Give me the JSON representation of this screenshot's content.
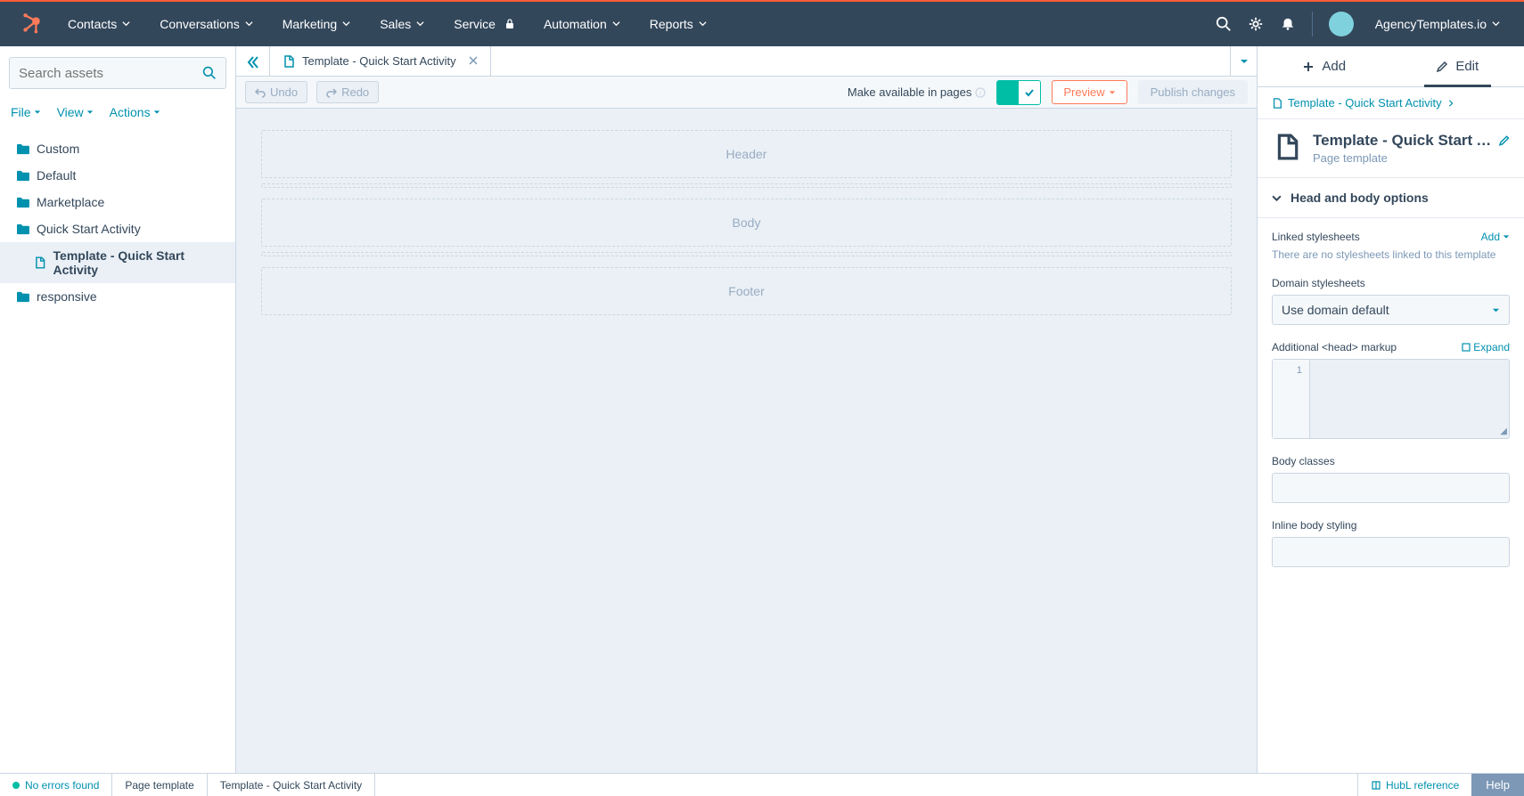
{
  "nav": {
    "items": [
      "Contacts",
      "Conversations",
      "Marketing",
      "Sales",
      "Service",
      "Automation",
      "Reports"
    ],
    "account": "AgencyTemplates.io"
  },
  "sidebar": {
    "search_placeholder": "Search assets",
    "actions": [
      "File",
      "View",
      "Actions"
    ],
    "folders": [
      "Custom",
      "Default",
      "Marketplace",
      "Quick Start Activity"
    ],
    "active_file": "Template - Quick Start Activity",
    "tail_folder": "responsive"
  },
  "tab": {
    "label": "Template - Quick Start Activity"
  },
  "toolbar": {
    "undo": "Undo",
    "redo": "Redo",
    "avail_label": "Make available in pages",
    "preview": "Preview",
    "publish": "Publish changes"
  },
  "canvas": {
    "header": "Header",
    "body": "Body",
    "footer": "Footer"
  },
  "right_panel": {
    "add_tab": "Add",
    "edit_tab": "Edit",
    "breadcrumb": "Template - Quick Start Activity",
    "title": "Template - Quick Start Act",
    "subtitle": "Page template",
    "section": "Head and body options",
    "linked_label": "Linked stylesheets",
    "linked_add": "Add",
    "linked_note": "There are no stylesheets linked to this template",
    "domain_label": "Domain stylesheets",
    "domain_value": "Use domain default",
    "head_label": "Additional <head> markup",
    "expand": "Expand",
    "code_line": "1",
    "body_classes_label": "Body classes",
    "inline_body_label": "Inline body styling"
  },
  "status": {
    "errors": "No errors found",
    "seg1": "Page template",
    "seg2": "Template - Quick Start Activity",
    "hubl": "HubL reference",
    "help": "Help"
  }
}
